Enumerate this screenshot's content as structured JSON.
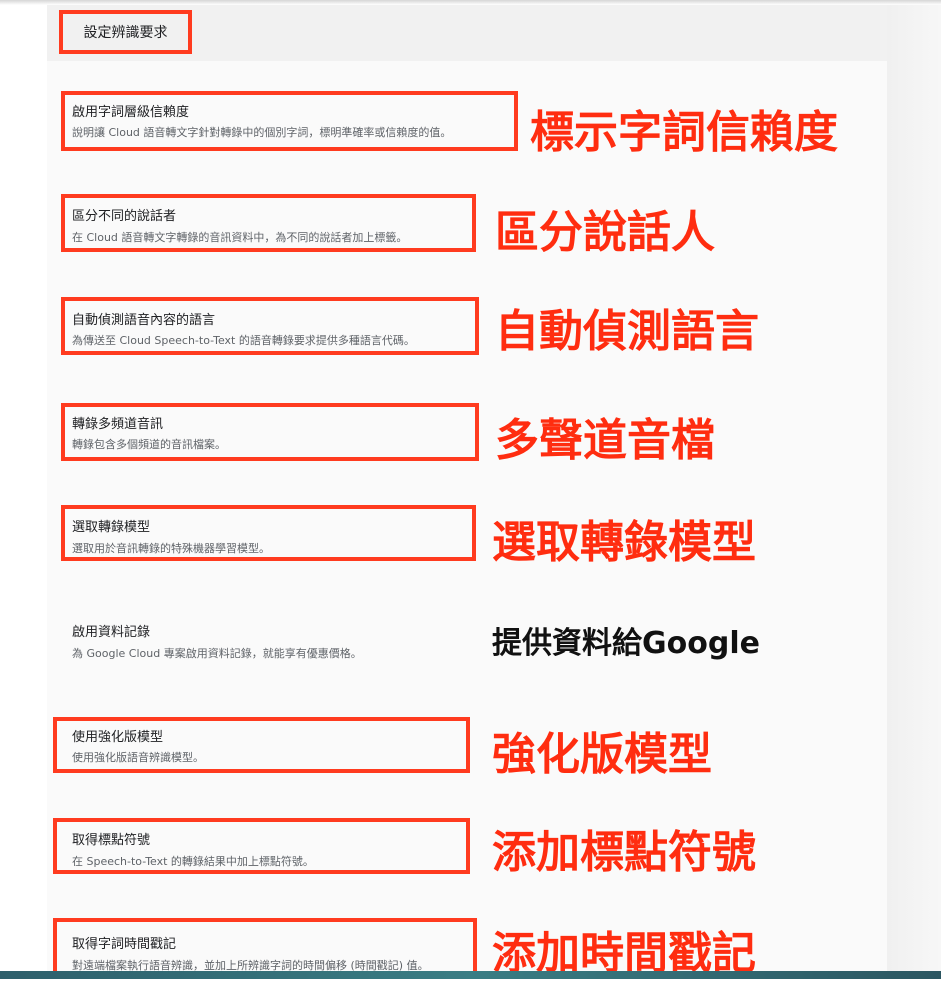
{
  "header": {
    "title": "設定辨識要求"
  },
  "rows": [
    {
      "title": "啟用字詞層級信賴度",
      "desc": "說明讓 Cloud 語音轉文字針對轉錄中的個別字詞，標明準確率或信賴度的值。",
      "annotation": "標示字詞信賴度"
    },
    {
      "title": "區分不同的說話者",
      "desc": "在 Cloud 語音轉文字轉錄的音訊資料中，為不同的說話者加上標籤。",
      "annotation": "區分說話人"
    },
    {
      "title": "自動偵測語音內容的語言",
      "desc": "為傳送至 Cloud Speech-to-Text 的語音轉錄要求提供多種語言代碼。",
      "annotation": "自動偵測語言"
    },
    {
      "title": "轉錄多頻道音訊",
      "desc": "轉錄包含多個頻道的音訊檔案。",
      "annotation": "多聲道音檔"
    },
    {
      "title": "選取轉錄模型",
      "desc": "選取用於音訊轉錄的特殊機器學習模型。",
      "annotation": "選取轉錄模型"
    },
    {
      "title": "啟用資料記錄",
      "desc": "為 Google Cloud 專案啟用資料記錄，就能享有優惠價格。",
      "annotation": "提供資料給Google"
    },
    {
      "title": "使用強化版模型",
      "desc": "使用強化版語音辨識模型。",
      "annotation": "強化版模型"
    },
    {
      "title": "取得標點符號",
      "desc": "在 Speech-to-Text 的轉錄結果中加上標點符號。",
      "annotation": "添加標點符號"
    },
    {
      "title": "取得字詞時間戳記",
      "desc": "對遠端檔案執行語音辨識，並加上所辨識字詞的時間偏移 (時間戳記) 值。",
      "annotation": "添加時間戳記"
    }
  ],
  "colors": {
    "highlight": "#ff3b1f",
    "annotation": "#ff2d10",
    "annotation_plain": "#111111"
  }
}
